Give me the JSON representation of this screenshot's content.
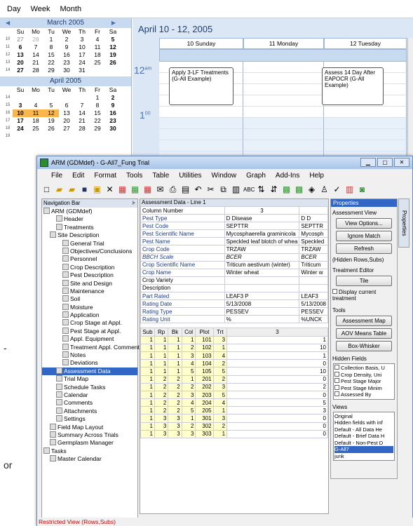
{
  "calendar": {
    "tabs": [
      "Day",
      "Week",
      "Month"
    ],
    "march": {
      "title": "March 2005",
      "dow": [
        "Su",
        "Mo",
        "Tu",
        "We",
        "Th",
        "Fr",
        "Sa"
      ],
      "weeks": [
        {
          "wk": "10",
          "days": [
            "27",
            "28",
            "1",
            "2",
            "3",
            "4",
            "5"
          ]
        },
        {
          "wk": "11",
          "days": [
            "6",
            "7",
            "8",
            "9",
            "10",
            "11",
            "12"
          ]
        },
        {
          "wk": "12",
          "days": [
            "13",
            "14",
            "15",
            "16",
            "17",
            "18",
            "19"
          ]
        },
        {
          "wk": "13",
          "days": [
            "20",
            "21",
            "22",
            "23",
            "24",
            "25",
            "26"
          ]
        },
        {
          "wk": "14",
          "days": [
            "27",
            "28",
            "29",
            "30",
            "31",
            "",
            ""
          ]
        }
      ]
    },
    "april": {
      "title": "April 2005",
      "dow": [
        "Su",
        "Mo",
        "Tu",
        "We",
        "Th",
        "Fr",
        "Sa"
      ],
      "weeks": [
        {
          "wk": "14",
          "days": [
            "",
            "",
            "",
            "",
            "",
            "1",
            "2"
          ]
        },
        {
          "wk": "15",
          "days": [
            "3",
            "4",
            "5",
            "6",
            "7",
            "8",
            "9"
          ]
        },
        {
          "wk": "16",
          "days": [
            "10",
            "11",
            "12",
            "13",
            "14",
            "15",
            "16"
          ]
        },
        {
          "wk": "17",
          "days": [
            "17",
            "18",
            "19",
            "20",
            "21",
            "22",
            "23"
          ]
        },
        {
          "wk": "18",
          "days": [
            "24",
            "25",
            "26",
            "27",
            "28",
            "29",
            "30"
          ]
        },
        {
          "wk": "19",
          "days": []
        }
      ]
    },
    "range_title": "April 10 - 12, 2005",
    "day_columns": [
      "10 Sunday",
      "11 Monday",
      "12 Tuesday"
    ],
    "time_12": "12",
    "time_am": "am",
    "time_1": "1",
    "time_00": "00",
    "appt1": "Apply 3-LF Treatments (G-All Example)",
    "appt2": "Assess 14 Day After EAPOCR (G-All Example)"
  },
  "window": {
    "title": "ARM (GDMdef) - G-All7_Fung Trial",
    "menu": [
      "File",
      "Edit",
      "Format",
      "Tools",
      "Table",
      "Utilities",
      "Window",
      "Graph",
      "Add-Ins",
      "Help"
    ],
    "status": "Restricted View (Rows,Subs)"
  },
  "nav": {
    "header": "Navigation Bar",
    "items": [
      {
        "label": "ARM (GDMdef)",
        "indent": 0
      },
      {
        "label": "Header",
        "indent": 2
      },
      {
        "label": "Treatments",
        "indent": 2
      },
      {
        "label": "Site Description",
        "indent": 1
      },
      {
        "label": "General Trial",
        "indent": 3
      },
      {
        "label": "Objectives/Conclusions",
        "indent": 3
      },
      {
        "label": "Personnel",
        "indent": 3
      },
      {
        "label": "Crop Description",
        "indent": 3
      },
      {
        "label": "Pest Description",
        "indent": 3
      },
      {
        "label": "Site and Design",
        "indent": 3
      },
      {
        "label": "Maintenance",
        "indent": 3
      },
      {
        "label": "Soil",
        "indent": 3
      },
      {
        "label": "Moisture",
        "indent": 3
      },
      {
        "label": "Application",
        "indent": 3
      },
      {
        "label": "Crop Stage at Appl.",
        "indent": 3
      },
      {
        "label": "Pest Stage at Appl.",
        "indent": 3
      },
      {
        "label": "Appl. Equipment",
        "indent": 3
      },
      {
        "label": "Treatment Appl. Comments",
        "indent": 3
      },
      {
        "label": "Notes",
        "indent": 3
      },
      {
        "label": "Deviations",
        "indent": 3
      },
      {
        "label": "Assessment Data",
        "indent": 2,
        "selected": true
      },
      {
        "label": "Trial Map",
        "indent": 2
      },
      {
        "label": "Schedule Tasks",
        "indent": 2
      },
      {
        "label": "Calendar",
        "indent": 2
      },
      {
        "label": "Comments",
        "indent": 2
      },
      {
        "label": "Attachments",
        "indent": 2
      },
      {
        "label": "Settings",
        "indent": 2
      },
      {
        "label": "Field Map Layout",
        "indent": 1
      },
      {
        "label": "Summary Across Trials",
        "indent": 1
      },
      {
        "label": "Germplasm Manager",
        "indent": 1
      },
      {
        "label": "Tasks",
        "indent": 0
      },
      {
        "label": "Master Calendar",
        "indent": 1
      }
    ]
  },
  "assess": {
    "header": "Assessment Data - Line 1",
    "props": [
      [
        "Column Number",
        "3",
        ""
      ],
      [
        "Pest Type",
        "D    Disease",
        "D  D"
      ],
      [
        "Pest Code",
        "SEPTTR",
        "SEPTTR"
      ],
      [
        "Pest Scientific Name",
        "Mycosphaerella graminicola",
        "Mycosph"
      ],
      [
        "Pest Name",
        "Speckled leaf blotch of whea",
        "Speckled"
      ],
      [
        "Crop Code",
        "TRZAW",
        "TRZAW"
      ],
      [
        "BBCH Scale",
        "BCER",
        "BCER"
      ],
      [
        "Crop Scientific Name",
        "Triticum aestivum (winter)",
        "Triticum"
      ],
      [
        "Crop Name",
        "Winter wheat",
        "Winter w"
      ],
      [
        "Crop Variety",
        "",
        ""
      ],
      [
        "Description",
        "",
        ""
      ],
      [
        "Part Rated",
        "LEAF3     P",
        "LEAF3"
      ],
      [
        "Rating Date",
        "5/13/2008",
        "5/13/2008"
      ],
      [
        "Rating Type",
        "PESSEV",
        "PESSEV"
      ],
      [
        "Rating Unit",
        "%",
        "%UNCK"
      ]
    ],
    "grid_headers": [
      "Sub",
      "Rp",
      "Bk",
      "Col",
      "Plot",
      "Trt",
      "3"
    ],
    "rows": [
      [
        "1",
        "1",
        "1",
        "1",
        "101",
        "3",
        "1"
      ],
      [
        "1",
        "1",
        "1",
        "2",
        "102",
        "1",
        "10"
      ],
      [
        "1",
        "1",
        "1",
        "3",
        "103",
        "4",
        "1"
      ],
      [
        "1",
        "1",
        "1",
        "4",
        "104",
        "2",
        "0"
      ],
      [
        "1",
        "1",
        "1",
        "5",
        "105",
        "5",
        "10"
      ],
      [
        "1",
        "2",
        "2",
        "1",
        "201",
        "2",
        "0"
      ],
      [
        "1",
        "2",
        "2",
        "2",
        "202",
        "3",
        "2"
      ],
      [
        "1",
        "2",
        "2",
        "3",
        "203",
        "5",
        "0"
      ],
      [
        "1",
        "2",
        "2",
        "4",
        "204",
        "4",
        "5"
      ],
      [
        "1",
        "2",
        "2",
        "5",
        "205",
        "1",
        "3"
      ],
      [
        "1",
        "3",
        "3",
        "1",
        "301",
        "3",
        "0"
      ],
      [
        "1",
        "3",
        "3",
        "2",
        "302",
        "2",
        "0"
      ],
      [
        "1",
        "3",
        "3",
        "3",
        "303",
        "1",
        "0"
      ]
    ]
  },
  "properties": {
    "header": "Properties",
    "side_tab": "Properties",
    "assessment_view": "Assessment View",
    "btn_view_options": "View Options...",
    "btn_ignore": "Ignore Match",
    "btn_refresh": "Refresh",
    "hidden_note": "(Hidden Rows,Subs)",
    "treatment_editor": "Treatment Editor",
    "btn_tile": "Tile",
    "display_current": "Display current treatment",
    "tools": "Tools",
    "btn_map": "Assessment Map",
    "btn_aov": "AOV Means Table",
    "btn_box": "Box-Whisker",
    "hidden_fields": "Hidden Fields",
    "hidden_list": [
      "Collection Basis, U",
      "Crop Density, Uni",
      "Pest Stage Major",
      "Pest Stage Minim",
      "Assessed By"
    ],
    "views": "Views",
    "views_list": [
      "Original",
      "Hidden fields with inf",
      "Default - All Data He",
      "Default - Brief Data H",
      "Default - Non-Pest D",
      "G-All7",
      "junk"
    ],
    "views_selected": "G-All7"
  },
  "stray": {
    "dash": "-",
    "or": "or"
  }
}
